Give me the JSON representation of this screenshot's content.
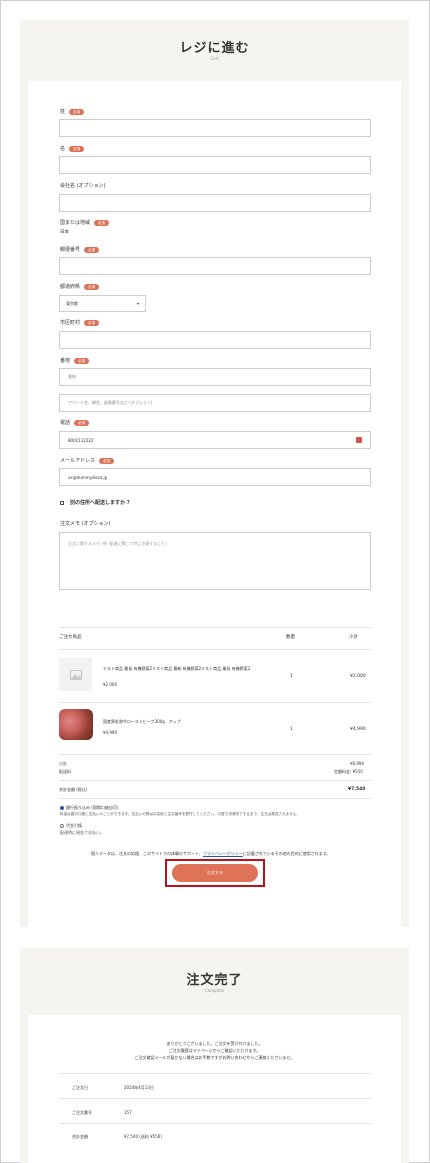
{
  "checkout": {
    "title": "レジに進む",
    "subtitle": "Cart"
  },
  "form": {
    "last_name": {
      "label": "姓",
      "badge": "必須"
    },
    "first_name": {
      "label": "名",
      "badge": "必須"
    },
    "company": {
      "label": "会社名 (オプション)"
    },
    "country": {
      "label": "国または地域",
      "badge": "必須",
      "value": "日本"
    },
    "postal": {
      "label": "郵便番号",
      "badge": "必須"
    },
    "prefecture": {
      "label": "都道府県",
      "badge": "必須",
      "value": "東京都"
    },
    "city": {
      "label": "市区町村",
      "badge": "必須"
    },
    "address": {
      "label": "番地",
      "badge": "必須",
      "placeholder1": "番地",
      "placeholder2": "アパート名、棟名、部屋番号など (オプション)"
    },
    "phone": {
      "label": "電話",
      "badge": "必須",
      "value": "8001112222"
    },
    "email": {
      "label": "メールアドレス",
      "badge": "必須",
      "value": "xx@dummydisco.jp"
    },
    "ship_other": {
      "label": "別の住所へ配送しますか ?"
    },
    "notes": {
      "label": "注文メモ (オプション)",
      "placeholder": "注文に関するメモ (例: 配達に関して特に注意すること)"
    }
  },
  "order": {
    "col_product": "ご注文商品",
    "col_qty": "数量",
    "col_subtotal": "小計",
    "items": [
      {
        "name": "テスト商品 最長 有機野菜2テスト商品 最新 有機野菜2テスト商品 最長 有機野菜2",
        "price": "¥2,000",
        "qty": "1",
        "subtotal": "¥2,000"
      },
      {
        "name": "国産黒毛和牛ローストビーフ300g　アップ",
        "price": "¥4,990",
        "qty": "1",
        "subtotal": "¥4,990"
      }
    ],
    "subtotal_label": "小計",
    "subtotal_value": "¥6,990",
    "shipping_label": "配送料",
    "shipping_value": "定額料金: ¥550",
    "total_label": "合計金額 (税込)",
    "total_value": "¥7,540",
    "pay1_label": "銀行振り込み (国際口座自可)",
    "pay1_desc": "料金は直行口座に支払いのことができます。支払いの際はお名前と注文番号を受付してください。口座で決済完了するまで、注文は発送されません。",
    "pay2_label": "代金引換",
    "pay2_desc": "配達時に現金でお払い。",
    "privacy_text": "個人データは、注文の処理、このサイトでの体験のサポート、",
    "privacy_link": "プライバシーポリシー",
    "privacy_after": "に記載されているその他の目的に使用されます。",
    "submit": "注文する"
  },
  "complete": {
    "title": "注文完了",
    "subtitle": "Complete",
    "msg1": "ありがとうございました。ご注文を受け付けました。",
    "msg2": "ご注文履歴はマイページからご確認いただけます。",
    "msg3": "ご注文確認メールが届かない場合はお手数ですがお問い合わせからご連絡くださいませ。",
    "rows": [
      {
        "label": "ご注文日",
        "value": "2024年4月13日"
      },
      {
        "label": "ご注文番号",
        "value": "157"
      },
      {
        "label": "合計金額",
        "value": "¥7,540 (送料 ¥550)"
      }
    ]
  },
  "colors": {
    "accent": "#df7358",
    "highlight": "#c0101a",
    "panel": "#f6f4ef",
    "link": "#2a55aa"
  }
}
